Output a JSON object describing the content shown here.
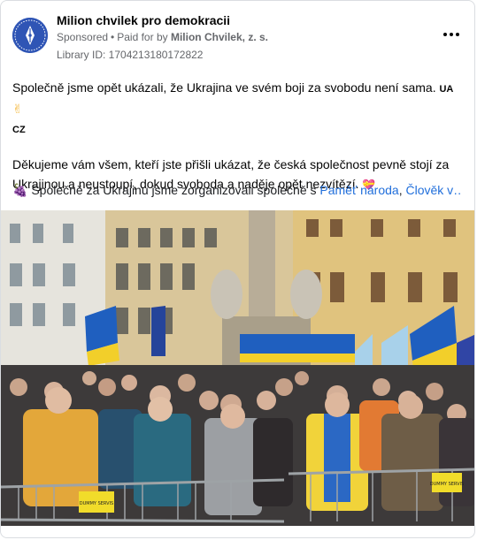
{
  "header": {
    "page_name": "Milion chvilek pro demokracii",
    "sponsored": "Sponsored",
    "paid_for_by_prefix": "Paid for by",
    "paid_for_by_name": "Milion Chvilek, z. s.",
    "library_id": "Library ID: 1704213180172822",
    "avatar_icon": "pen-nib-logo-icon",
    "more_icon": "more-options-icon"
  },
  "post": {
    "line1": "Společně jsme opět ukázali, že Ukrajina ve svém boji za svobodu není sama.",
    "line1_tag_ua": "UA",
    "line1_tag_cz": "CZ",
    "line2": "Děkujeme vám všem, kteří jste přišli ukázat, že česká společnost pevně stojí za Ukrajinou a neustoupí, dokud svoboda a naděje opět nezvítězí.",
    "line3_prefix": "Společně za Ukrajinu jsme zorganizovali společně s",
    "line3_link1": "Paměť národa",
    "line3_sep": ",",
    "line3_link2": "Člověk v…"
  },
  "photo": {
    "icon": "rally-photo-image",
    "sign_text": "DUMMY SERVIS"
  },
  "colors": {
    "accent_link": "#216fdb",
    "avatar_bg": "#2f55b5",
    "ukraine_blue": "#1f5fbf",
    "ukraine_yellow": "#f2cf2a"
  }
}
